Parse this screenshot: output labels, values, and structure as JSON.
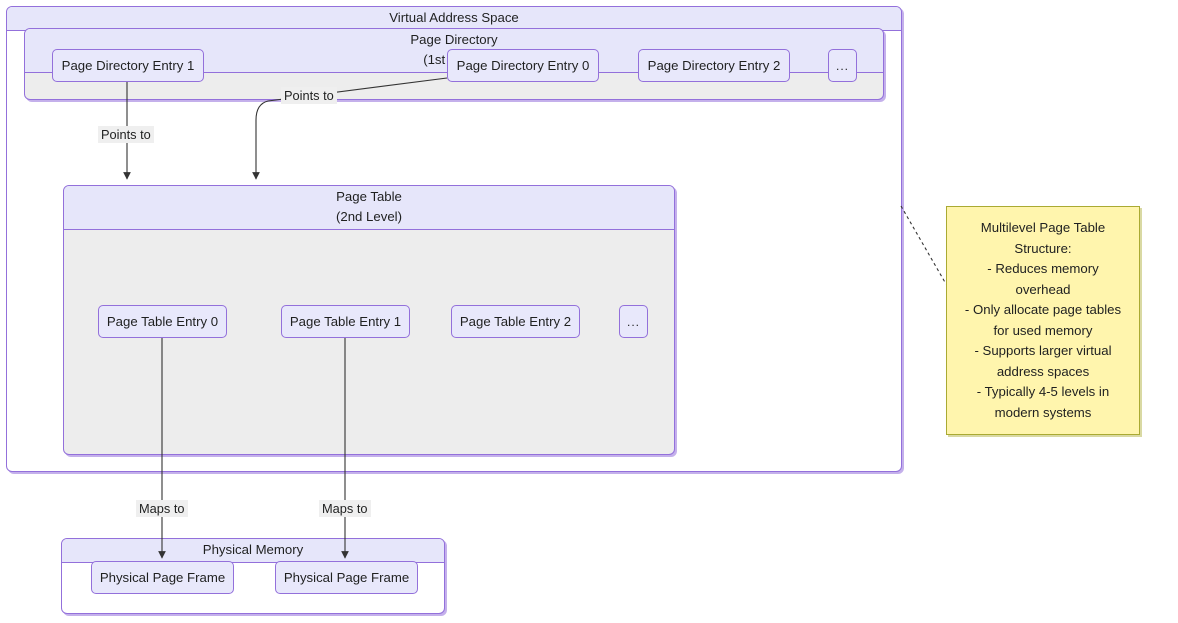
{
  "diagram": {
    "title": "Multilevel Page Table Structure",
    "type": "flowchart"
  },
  "clusters": {
    "virtual_address_space": {
      "label": "Virtual Address Space"
    },
    "page_directory": {
      "line1": "Page Directory",
      "line2": "(1st Level)"
    },
    "page_table": {
      "line1": "Page Table",
      "line2": "(2nd Level)"
    },
    "physical_memory": {
      "label": "Physical Memory"
    }
  },
  "nodes": {
    "pde1": "Page Directory Entry 1",
    "pde0": "Page Directory Entry 0",
    "pde2": "Page Directory Entry 2",
    "pde_more": "...",
    "pte0": "Page Table Entry 0",
    "pte1": "Page Table Entry 1",
    "pte2": "Page Table Entry 2",
    "pte_more": "...",
    "frame_a": "Physical Page Frame",
    "frame_b": "Physical Page Frame"
  },
  "edge_labels": {
    "points_to_a": "Points to",
    "points_to_b": "Points to",
    "maps_to_a": "Maps to",
    "maps_to_b": "Maps to"
  },
  "note": {
    "text": "Multilevel Page Table Structure: - Reduces memory overhead - Only allocate page tables for used memory - Supports larger virtual address spaces - Typically 4-5 levels in modern systems",
    "lines": [
      "Multilevel Page Table",
      "Structure:",
      "- Reduces memory",
      "overhead",
      "- Only allocate page tables",
      "for used memory",
      "- Supports larger virtual",
      "address spaces",
      "- Typically 4-5 levels in",
      "modern systems"
    ]
  },
  "colors": {
    "node_fill": "#e8e8fb",
    "node_stroke": "#9370db",
    "cluster_header_fill": "#e6e6fa",
    "cluster_body_fill": "#ededed",
    "note_fill": "#fff5ad",
    "note_stroke": "#aaaa33",
    "edge_stroke": "#333333",
    "edge_label_bg": "#efefef"
  }
}
